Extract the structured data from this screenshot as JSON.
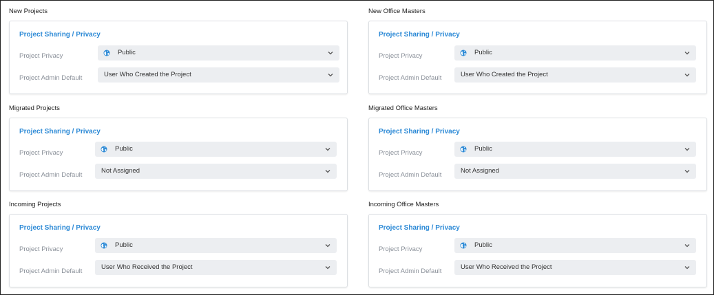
{
  "sections": {
    "left": [
      {
        "title": "New Projects",
        "card_title": "Project Sharing / Privacy",
        "privacy_label": "Project Privacy",
        "privacy_value": "Public",
        "admin_label": "Project Admin Default",
        "admin_value": "User Who Created the Project"
      },
      {
        "title": "Migrated Projects",
        "card_title": "Project Sharing / Privacy",
        "privacy_label": "Project Privacy",
        "privacy_value": "Public",
        "admin_label": "Project Admin Default",
        "admin_value": "Not Assigned"
      },
      {
        "title": "Incoming Projects",
        "card_title": "Project Sharing / Privacy",
        "privacy_label": "Project Privacy",
        "privacy_value": "Public",
        "admin_label": "Project Admin Default",
        "admin_value": "User Who Received the Project"
      }
    ],
    "right": [
      {
        "title": "New Office Masters",
        "card_title": "Project Sharing / Privacy",
        "privacy_label": "Project Privacy",
        "privacy_value": "Public",
        "admin_label": "Project Admin Default",
        "admin_value": "User Who Created the Project"
      },
      {
        "title": "Migrated Office Masters",
        "card_title": "Project Sharing / Privacy",
        "privacy_label": "Project Privacy",
        "privacy_value": "Public",
        "admin_label": "Project Admin Default",
        "admin_value": "Not Assigned"
      },
      {
        "title": "Incoming Office Masters",
        "card_title": "Project Sharing / Privacy",
        "privacy_label": "Project Privacy",
        "privacy_value": "Public",
        "admin_label": "Project Admin Default",
        "admin_value": "User Who Received the Project"
      }
    ]
  },
  "icons": {
    "globe": "globe-icon",
    "chevron": "chevron-down-icon"
  },
  "colors": {
    "accent": "#2d8ad6",
    "select_bg": "#eceef1",
    "label": "#8a9099"
  }
}
